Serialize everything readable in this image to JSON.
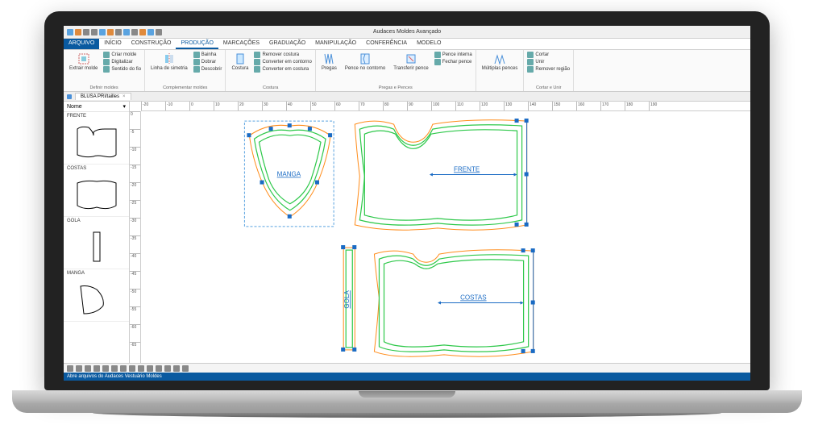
{
  "app": {
    "title": "Audaces Moldes Avançado"
  },
  "tabs": {
    "file": "ARQUIVO",
    "items": [
      "INÍCIO",
      "CONSTRUÇÃO",
      "PRODUÇÃO",
      "MARCAÇÕES",
      "GRADUAÇÃO",
      "MANIPULAÇÃO",
      "CONFERÊNCIA",
      "MODELO"
    ],
    "selected_index": 2
  },
  "ribbon": {
    "groups": [
      {
        "title": "Definir moldes",
        "big": {
          "label": "Extrair molde"
        },
        "small": [
          "Criar molde",
          "Digitalizar",
          "Sentido do fio"
        ]
      },
      {
        "title": "Complementar moldes",
        "big": {
          "label": "Linha de simetria"
        },
        "small": [
          "Bainha",
          "Dobrar",
          "Descobrir"
        ]
      },
      {
        "title": "Costura",
        "big": {
          "label": "Costura"
        },
        "small": [
          "Remover costura",
          "Converter em contorno",
          "Converter em costura"
        ]
      },
      {
        "title": "Pregas e Pences",
        "big": {
          "label": "Pregas"
        },
        "big2": {
          "label": "Pence no contorno"
        },
        "big3": {
          "label": "Transferir pence"
        },
        "small": [
          "Pence interna",
          "Fechar pence"
        ]
      },
      {
        "title": "",
        "big": {
          "label": "Múltiplas pences"
        }
      },
      {
        "title": "Cortar e Unir",
        "small": [
          "Cortar",
          "Unir",
          "Remover região"
        ]
      }
    ]
  },
  "document": {
    "tab_name": "BLUSA PRI/tailles",
    "close": "×"
  },
  "ruler_h": [
    "-20",
    "-10",
    "0",
    "10",
    "20",
    "30",
    "40",
    "50",
    "60",
    "70",
    "80",
    "90",
    "100",
    "110",
    "120",
    "130",
    "140",
    "150",
    "160",
    "170",
    "180",
    "190"
  ],
  "ruler_v": [
    "0",
    "-5",
    "-10",
    "-15",
    "-20",
    "-25",
    "-30",
    "-35",
    "-40",
    "-45",
    "-50",
    "-55",
    "-60",
    "-65"
  ],
  "sidepanel": {
    "head": "Nome",
    "items": [
      {
        "label": "FRENTE"
      },
      {
        "label": "COSTAS"
      },
      {
        "label": "GOLA"
      },
      {
        "label": "MANGA"
      }
    ]
  },
  "pieces": {
    "manga": "MANGA",
    "frente": "FRENTE",
    "gola": "GOLA",
    "costas": "COSTAS"
  },
  "statusbar": "Abre arquivos do Audaces Vestuário Moldes"
}
